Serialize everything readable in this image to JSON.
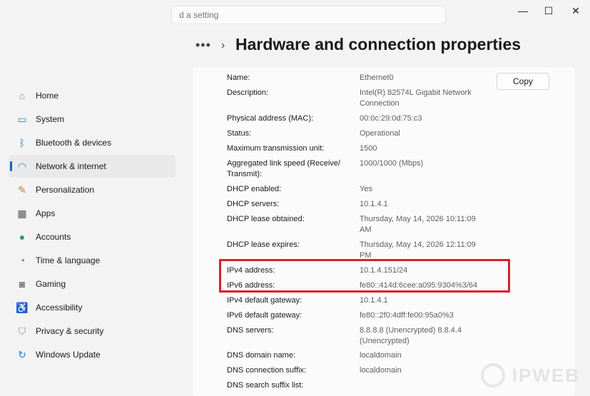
{
  "search": {
    "placeholder": "d a setting"
  },
  "window": {
    "minimize": "—",
    "maximize": "☐",
    "close": "✕"
  },
  "header": {
    "more": "•••",
    "chevron": "›",
    "title": "Hardware and connection properties"
  },
  "nav": [
    {
      "label": "Home",
      "icon": "home-icon",
      "color": "#c0793a"
    },
    {
      "label": "System",
      "icon": "system-icon",
      "color": "#2b84d6"
    },
    {
      "label": "Bluetooth & devices",
      "icon": "bluetooth-icon",
      "color": "#2b84d6"
    },
    {
      "label": "Network & internet",
      "icon": "wifi-icon",
      "color": "#2b84d6",
      "active": true
    },
    {
      "label": "Personalization",
      "icon": "brush-icon",
      "color": "#c07a3a"
    },
    {
      "label": "Apps",
      "icon": "apps-icon",
      "color": "#555555"
    },
    {
      "label": "Accounts",
      "icon": "person-icon",
      "color": "#2f9e6a"
    },
    {
      "label": "Time & language",
      "icon": "globe-clock-icon",
      "color": "#2b84d6"
    },
    {
      "label": "Gaming",
      "icon": "gamepad-icon",
      "color": "#777777"
    },
    {
      "label": "Accessibility",
      "icon": "accessibility-icon",
      "color": "#2b84d6"
    },
    {
      "label": "Privacy & security",
      "icon": "shield-icon",
      "color": "#888888"
    },
    {
      "label": "Windows Update",
      "icon": "update-icon",
      "color": "#2b84d6"
    }
  ],
  "copy_label": "Copy",
  "properties": [
    {
      "k": "Name:",
      "v": "Ethernet0"
    },
    {
      "k": "Description:",
      "v": "Intel(R) 82574L Gigabit Network Connection"
    },
    {
      "k": "Physical address (MAC):",
      "v": "00:0c:29:0d:75:c3"
    },
    {
      "k": "Status:",
      "v": "Operational"
    },
    {
      "k": "Maximum transmission unit:",
      "v": "1500"
    },
    {
      "k": "Aggregated link speed (Receive/ Transmit):",
      "v": "1000/1000 (Mbps)"
    },
    {
      "k": "DHCP enabled:",
      "v": "Yes"
    },
    {
      "k": "DHCP servers:",
      "v": "10.1.4.1"
    },
    {
      "k": "DHCP lease obtained:",
      "v": "Thursday, May 14, 2026 10:11:09 AM"
    },
    {
      "k": "DHCP lease expires:",
      "v": "Thursday, May 14, 2026 12:11:09 PM"
    },
    {
      "k": "IPv4 address:",
      "v": "10.1.4.151/24"
    },
    {
      "k": "IPv6 address:",
      "v": "fe80::414d:6cee:a095:9304%3/64"
    },
    {
      "k": "IPv4 default gateway:",
      "v": "10.1.4.1"
    },
    {
      "k": "IPv6 default gateway:",
      "v": "fe80::2f0:4dff:fe00:95a0%3"
    },
    {
      "k": "DNS servers:",
      "v": "8.8.8.8 (Unencrypted) 8.8.4.4 (Unencrypted)"
    },
    {
      "k": "DNS domain name:",
      "v": "localdomain"
    },
    {
      "k": "DNS connection suffix:",
      "v": "localdomain"
    },
    {
      "k": "DNS search suffix list:",
      "v": ""
    }
  ],
  "watermark": "IPWEB",
  "highlight_color": "#d4232a"
}
